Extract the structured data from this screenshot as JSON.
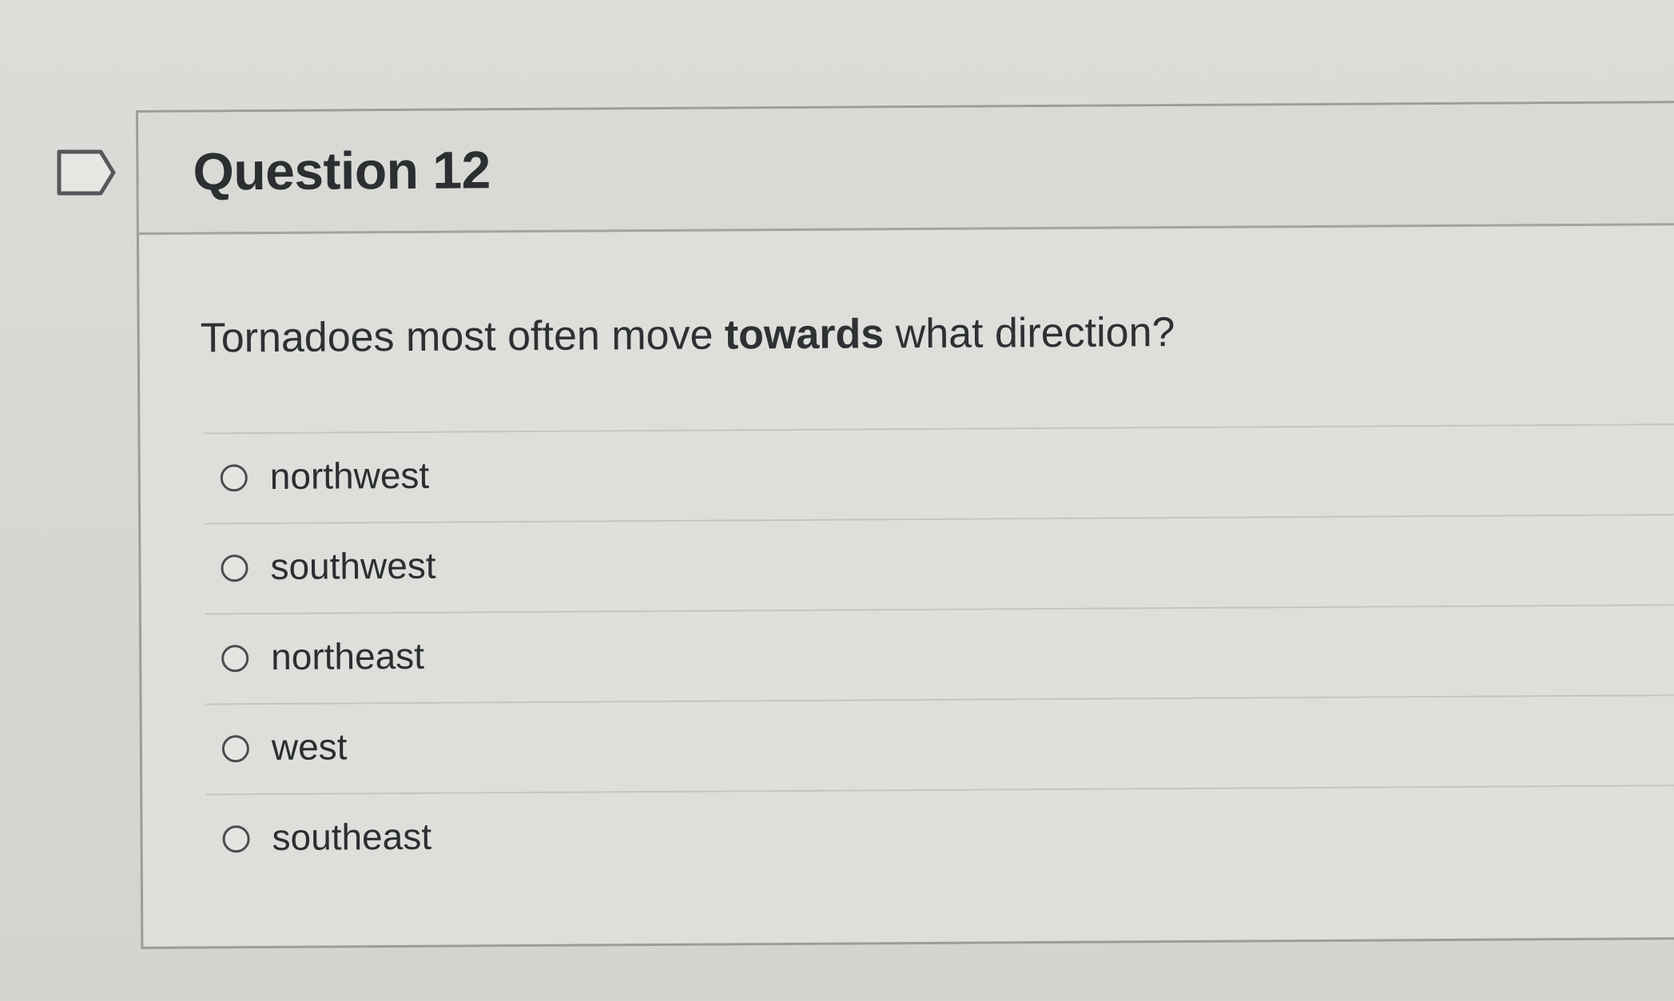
{
  "question": {
    "title": "Question 12",
    "text_before": "Tornadoes most often move ",
    "text_bold": "towards",
    "text_after": " what direction?"
  },
  "answers": [
    {
      "label": "northwest",
      "selected": false
    },
    {
      "label": "southwest",
      "selected": false
    },
    {
      "label": "northeast",
      "selected": false
    },
    {
      "label": "west",
      "selected": false
    },
    {
      "label": "southeast",
      "selected": false
    }
  ],
  "icons": {
    "flag": "flag-question-icon",
    "radio": "radio-button-icon"
  },
  "colors": {
    "background": "#d9dad6",
    "text": "#2b2f31",
    "border": "#9c9d99"
  }
}
